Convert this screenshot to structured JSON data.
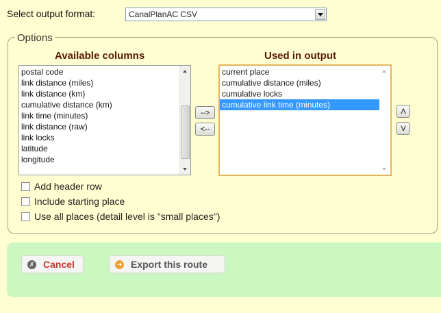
{
  "format": {
    "label": "Select output format:",
    "selected": "CanalPlanAC CSV"
  },
  "options": {
    "legend": "Options",
    "available": {
      "heading": "Available columns",
      "items": [
        "postal code",
        "link distance (miles)",
        "link distance (km)",
        "cumulative distance (km)",
        "link time (minutes)",
        "link distance (raw)",
        "link locks",
        "latitude",
        "longitude"
      ]
    },
    "used": {
      "heading": "Used in output",
      "items": [
        "current place",
        "cumulative distance (miles)",
        "cumulative locks",
        "cumulative link time (minutes)"
      ],
      "selected_index": 3
    },
    "move_right_label": "-->",
    "move_left_label": "<--",
    "move_up_label": "Λ",
    "move_down_label": "V",
    "checkboxes": [
      {
        "label": "Add header row",
        "checked": false
      },
      {
        "label": "Include starting place",
        "checked": false
      },
      {
        "label": "Use all places (detail level is \"small places\")",
        "checked": false
      }
    ]
  },
  "actions": {
    "cancel_label": "Cancel",
    "cancel_icon": "cancel-circle-icon",
    "export_label": "Export this route",
    "export_icon": "arrow-right-circle-icon",
    "cancel_color": "#c0392b",
    "export_color": "#555555"
  }
}
